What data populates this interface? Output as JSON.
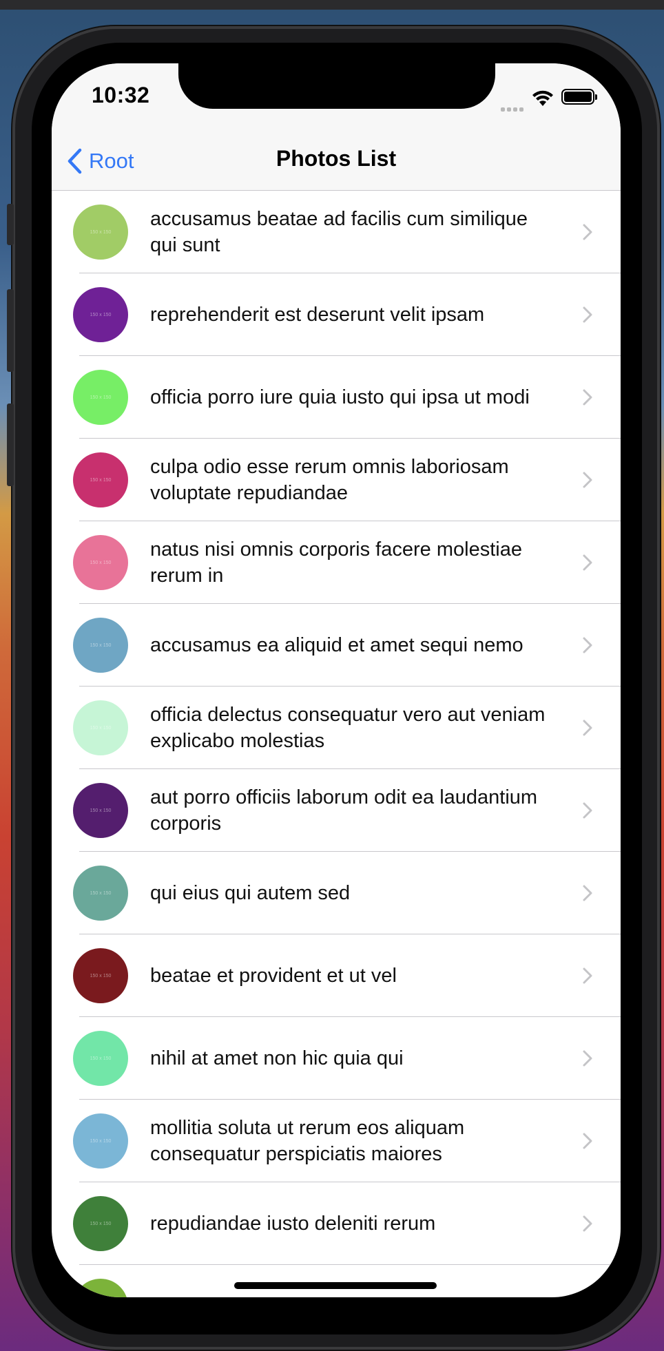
{
  "status_bar": {
    "time": "10:32"
  },
  "navbar": {
    "back_label": "Root",
    "title": "Photos List"
  },
  "rows": [
    {
      "title": "accusamus beatae ad facilis cum similique qui sunt",
      "color": "#a1cc66",
      "thumb_text": "150 x 150"
    },
    {
      "title": "reprehenderit est deserunt velit ipsam",
      "color": "#6f2196",
      "thumb_text": "150 x 150"
    },
    {
      "title": "officia porro iure quia iusto qui ipsa ut modi",
      "color": "#77ee66",
      "thumb_text": "150 x 150"
    },
    {
      "title": "culpa odio esse rerum omnis laboriosam voluptate repudiandae",
      "color": "#c8306e",
      "thumb_text": "150 x 150"
    },
    {
      "title": "natus nisi omnis corporis facere molestiae rerum in",
      "color": "#e87398",
      "thumb_text": "150 x 150"
    },
    {
      "title": "accusamus ea aliquid et amet sequi nemo",
      "color": "#6fa6c4",
      "thumb_text": "150 x 150"
    },
    {
      "title": "officia delectus consequatur vero aut veniam explicabo molestias",
      "color": "#c6f5d6",
      "thumb_text": "150 x 150"
    },
    {
      "title": "aut porro officiis laborum odit ea laudantium corporis",
      "color": "#541e6e",
      "thumb_text": "150 x 150"
    },
    {
      "title": "qui eius qui autem sed",
      "color": "#6aa89a",
      "thumb_text": "150 x 150"
    },
    {
      "title": "beatae et provident et ut vel",
      "color": "#7a1a1e",
      "thumb_text": "150 x 150"
    },
    {
      "title": "nihil at amet non hic quia qui",
      "color": "#72e6a8",
      "thumb_text": "150 x 150"
    },
    {
      "title": "mollitia soluta ut rerum eos aliquam consequatur perspiciatis maiores",
      "color": "#7bb6d6",
      "thumb_text": "150 x 150"
    },
    {
      "title": "repudiandae iusto deleniti rerum",
      "color": "#3f803a",
      "thumb_text": "150 x 150"
    },
    {
      "title": "",
      "color": "#7cb33a",
      "thumb_text": ""
    }
  ]
}
